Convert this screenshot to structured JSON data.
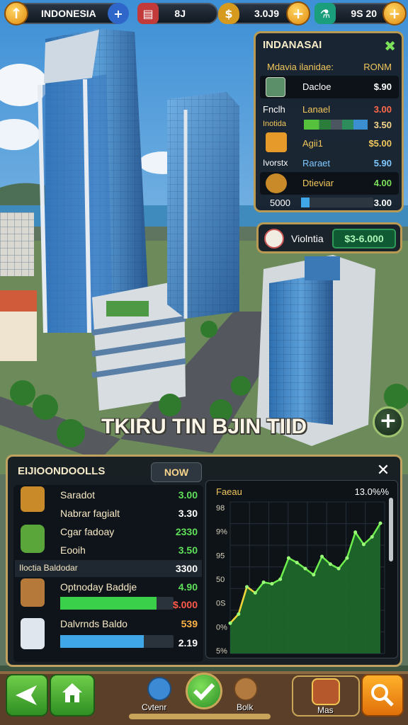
{
  "topbar": {
    "country": "INDONESIA",
    "resource_a": "8J",
    "resource_b": "3.0J9",
    "resource_c": "9S 20"
  },
  "market_panel": {
    "title": "INDANASAI",
    "header_left": "Mdavia ilanidae:",
    "header_right": "RONM",
    "rows": [
      {
        "a": "",
        "b": "Dacloe",
        "c": "$.90"
      },
      {
        "a": "Fnclh",
        "b": "Lanael",
        "c": "3.00"
      },
      {
        "a": "Inotida",
        "b": "",
        "c": "3.50"
      },
      {
        "a": "",
        "b": "Agii1",
        "c": "$5.00"
      },
      {
        "a": "Ivorstx",
        "b": "Raraet",
        "c": "5.90"
      },
      {
        "a": "",
        "b": "Dtieviar",
        "c": "4.00"
      },
      {
        "a": "5000",
        "b": "",
        "c": "3.00"
      }
    ]
  },
  "balance_panel": {
    "label": "Violntia",
    "amount": "$3-6.000"
  },
  "banner_text": "TKIRU TIN BJIN TIID",
  "portfolio": {
    "title": "EIJIOONDOOLLS",
    "now_label": "NOW",
    "rows": [
      {
        "name": "Saradot",
        "value": "3.00",
        "color": "#5fe05a"
      },
      {
        "name": "Nabrar fagialt",
        "value": "3.30",
        "color": "#ffffff"
      },
      {
        "name": "Cgar fadoay",
        "value": "2330",
        "color": "#5fe05a"
      },
      {
        "name": "Eooih",
        "value": "3.50",
        "color": "#5fe05a"
      },
      {
        "name": "Iloctia    Baldodar",
        "value": "3300",
        "color": "#ffffff"
      },
      {
        "name": "Optnoday Baddje",
        "value": "4.90",
        "color": "#5fe05a"
      },
      {
        "name": "",
        "value": "$.000",
        "color": "#ff5a4a"
      },
      {
        "name": "Dalvrnds Baldo",
        "value": "539",
        "color": "#ffb347"
      },
      {
        "name": "",
        "value": "2.19",
        "color": "#ffffff"
      }
    ],
    "progress_green": 0.85,
    "progress_blue": 0.74
  },
  "chart_data": {
    "type": "area",
    "title": "Faeau",
    "top_right_label": "13.0%%",
    "y_tick_labels": [
      "98",
      "9%",
      "95",
      "50",
      "0S",
      "0%",
      "5%"
    ],
    "values": [
      20,
      26,
      44,
      40,
      47,
      46,
      49,
      63,
      60,
      56,
      52,
      64,
      59,
      56,
      63,
      80,
      72,
      77,
      86
    ]
  },
  "bottom_nav": {
    "center_left_label": "Cvtenr",
    "center_right_label": "Bolk",
    "right_label": "Mas"
  }
}
